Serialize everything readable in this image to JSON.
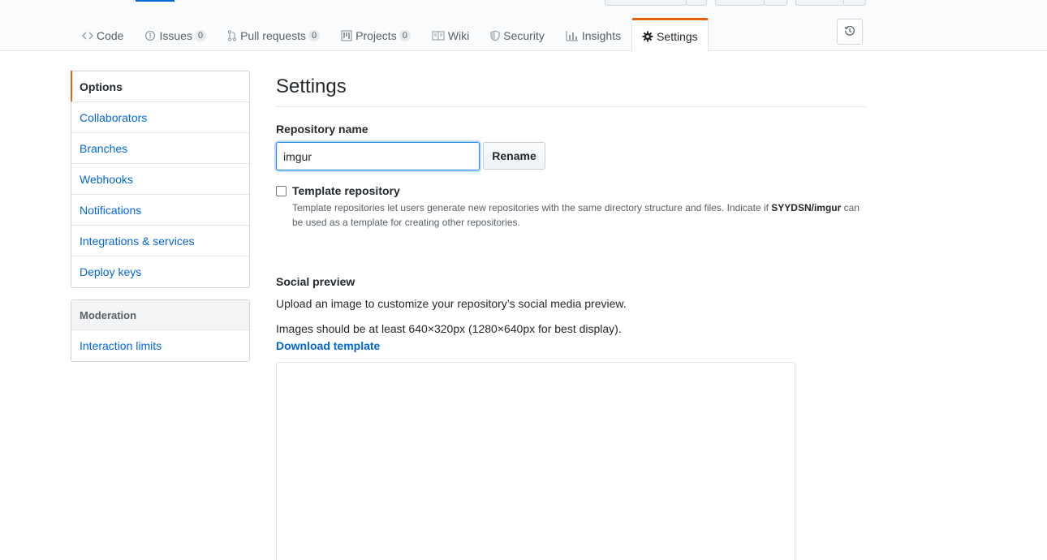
{
  "tabs": [
    {
      "label": "Code",
      "icon": "code-icon",
      "counter": null
    },
    {
      "label": "Issues",
      "icon": "issue-icon",
      "counter": "0"
    },
    {
      "label": "Pull requests",
      "icon": "pull-request-icon",
      "counter": "0"
    },
    {
      "label": "Projects",
      "icon": "project-icon",
      "counter": "0"
    },
    {
      "label": "Wiki",
      "icon": "book-icon",
      "counter": null
    },
    {
      "label": "Security",
      "icon": "shield-icon",
      "counter": null
    },
    {
      "label": "Insights",
      "icon": "graph-icon",
      "counter": null
    },
    {
      "label": "Settings",
      "icon": "gear-icon",
      "counter": null,
      "selected": true
    }
  ],
  "sidebar": {
    "items": [
      "Options",
      "Collaborators",
      "Branches",
      "Webhooks",
      "Notifications",
      "Integrations & services",
      "Deploy keys"
    ],
    "moderation_heading": "Moderation",
    "moderation_items": [
      "Interaction limits"
    ]
  },
  "main": {
    "title": "Settings",
    "repo_name_label": "Repository name",
    "repo_name_value": "imgur",
    "rename_label": "Rename",
    "template_label": "Template repository",
    "template_note_pre": "Template repositories let users generate new repositories with the same directory structure and files. Indicate if ",
    "template_note_repo": "SYYDSN/imgur",
    "template_note_post": " can be used as a template for creating other repositories.",
    "social_heading": "Social preview",
    "social_desc": "Upload an image to customize your repository’s social media preview.",
    "social_size": "Images should be at least 640×320px (1280×640px for best display).",
    "download_link": "Download template"
  },
  "colors": {
    "accent": "#e36209",
    "link": "#0366d6",
    "focus": "#2188ff"
  }
}
